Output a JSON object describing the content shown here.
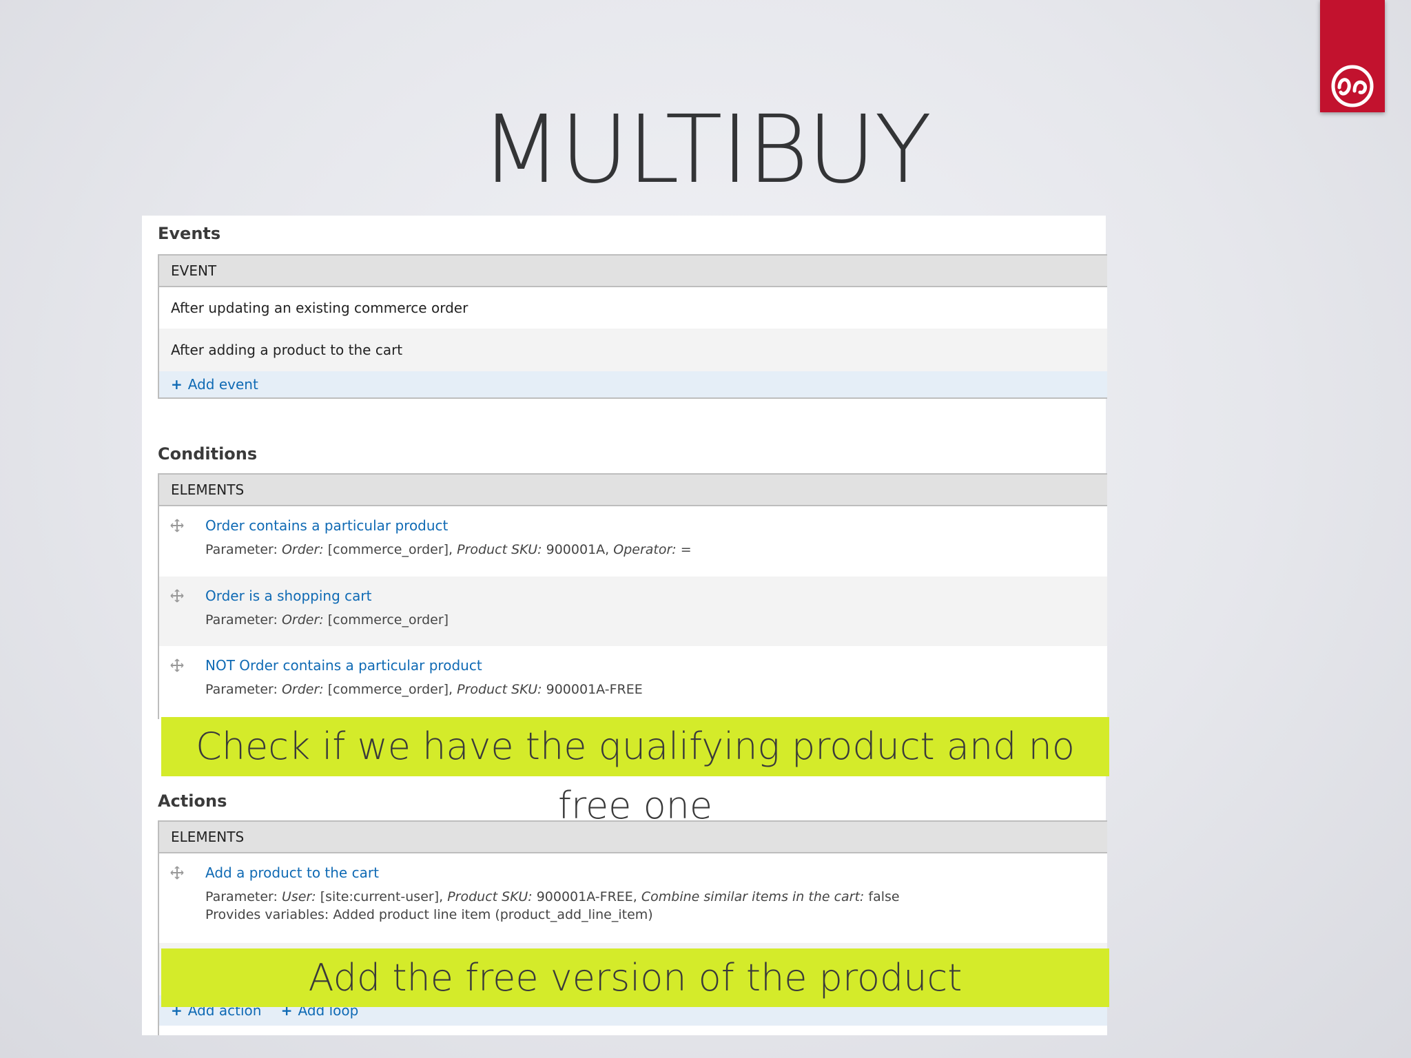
{
  "slide": {
    "title": "MULTIBUY",
    "logo": "drupal-logo-icon"
  },
  "events": {
    "heading": "Events",
    "column": "EVENT",
    "rows": [
      "After updating an existing commerce order",
      "After adding a product to the cart"
    ],
    "add_label": "Add event"
  },
  "conditions": {
    "heading": "Conditions",
    "column": "ELEMENTS",
    "items": [
      {
        "title": "Order contains a particular product",
        "param_label": "Parameter:",
        "p1_key": "Order:",
        "p1_val": "[commerce_order],",
        "p2_key": "Product SKU:",
        "p2_val": "900001A,",
        "p3_key": "Operator:",
        "p3_val": "="
      },
      {
        "title": "Order is a shopping cart",
        "param_label": "Parameter:",
        "p1_key": "Order:",
        "p1_val": "[commerce_order]"
      },
      {
        "title": "NOT Order contains a particular product",
        "param_label": "Parameter:",
        "p1_key": "Order:",
        "p1_val": "[commerce_order],",
        "p2_key": "Product SKU:",
        "p2_val": "900001A-FREE"
      }
    ],
    "callout": "Check if we have the qualifying product and no free one"
  },
  "actions": {
    "heading": "Actions",
    "column": "ELEMENTS",
    "items": [
      {
        "title": "Add a product to the cart",
        "param_label": "Parameter:",
        "p1_key": "User:",
        "p1_val": "[site:current-user],",
        "p2_key": "Product SKU:",
        "p2_val": "900001A-FREE,",
        "p3_key": "Combine similar items in the cart:",
        "p3_val": "false",
        "provides": "Provides variables: Added product line item (product_add_line_item)"
      }
    ],
    "callout": "Add the free version of the product",
    "add_action_label": "Add action",
    "add_loop_label": "Add loop"
  },
  "colors": {
    "logo_bg": "#c2122e",
    "link": "#0f6ab4",
    "highlight": "#d4eb2a"
  }
}
